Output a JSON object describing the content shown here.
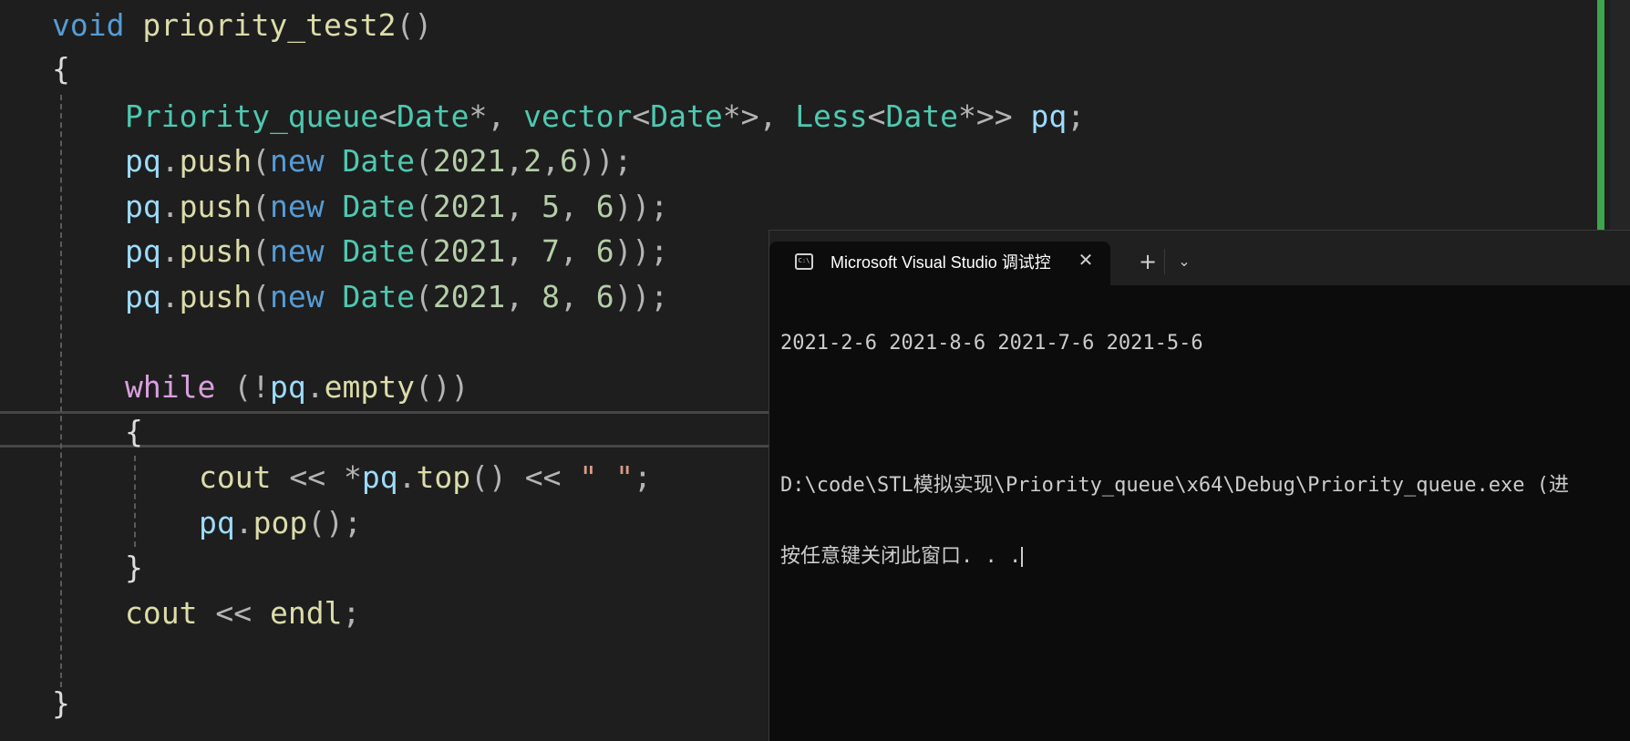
{
  "editor": {
    "lines": [
      {
        "tokens": [
          [
            "kw",
            "void"
          ],
          [
            "plain",
            " "
          ],
          [
            "fn",
            "priority_test2"
          ],
          [
            "punc",
            "()"
          ]
        ]
      },
      {
        "tokens": [
          [
            "brace",
            "{"
          ]
        ]
      },
      {
        "tokens": [
          [
            "type",
            "Priority_queue"
          ],
          [
            "punc",
            "<"
          ],
          [
            "type",
            "Date"
          ],
          [
            "punc",
            "*, "
          ],
          [
            "type",
            "vector"
          ],
          [
            "punc",
            "<"
          ],
          [
            "type",
            "Date"
          ],
          [
            "punc",
            "*>, "
          ],
          [
            "type",
            "Less"
          ],
          [
            "punc",
            "<"
          ],
          [
            "type",
            "Date"
          ],
          [
            "punc",
            "*>> "
          ],
          [
            "var",
            "pq"
          ],
          [
            "punc",
            ";"
          ]
        ]
      },
      {
        "tokens": [
          [
            "var",
            "pq"
          ],
          [
            "punc",
            "."
          ],
          [
            "fn",
            "push"
          ],
          [
            "punc",
            "("
          ],
          [
            "kw",
            "new"
          ],
          [
            "plain",
            " "
          ],
          [
            "type",
            "Date"
          ],
          [
            "punc",
            "("
          ],
          [
            "num",
            "2021"
          ],
          [
            "punc",
            ","
          ],
          [
            "num",
            "2"
          ],
          [
            "punc",
            ","
          ],
          [
            "num",
            "6"
          ],
          [
            "punc",
            "));"
          ]
        ]
      },
      {
        "tokens": [
          [
            "var",
            "pq"
          ],
          [
            "punc",
            "."
          ],
          [
            "fn",
            "push"
          ],
          [
            "punc",
            "("
          ],
          [
            "kw",
            "new"
          ],
          [
            "plain",
            " "
          ],
          [
            "type",
            "Date"
          ],
          [
            "punc",
            "("
          ],
          [
            "num",
            "2021"
          ],
          [
            "punc",
            ", "
          ],
          [
            "num",
            "5"
          ],
          [
            "punc",
            ", "
          ],
          [
            "num",
            "6"
          ],
          [
            "punc",
            "));"
          ]
        ]
      },
      {
        "tokens": [
          [
            "var",
            "pq"
          ],
          [
            "punc",
            "."
          ],
          [
            "fn",
            "push"
          ],
          [
            "punc",
            "("
          ],
          [
            "kw",
            "new"
          ],
          [
            "plain",
            " "
          ],
          [
            "type",
            "Date"
          ],
          [
            "punc",
            "("
          ],
          [
            "num",
            "2021"
          ],
          [
            "punc",
            ", "
          ],
          [
            "num",
            "7"
          ],
          [
            "punc",
            ", "
          ],
          [
            "num",
            "6"
          ],
          [
            "punc",
            "));"
          ]
        ]
      },
      {
        "tokens": [
          [
            "var",
            "pq"
          ],
          [
            "punc",
            "."
          ],
          [
            "fn",
            "push"
          ],
          [
            "punc",
            "("
          ],
          [
            "kw",
            "new"
          ],
          [
            "plain",
            " "
          ],
          [
            "type",
            "Date"
          ],
          [
            "punc",
            "("
          ],
          [
            "num",
            "2021"
          ],
          [
            "punc",
            ", "
          ],
          [
            "num",
            "8"
          ],
          [
            "punc",
            ", "
          ],
          [
            "num",
            "6"
          ],
          [
            "punc",
            "));"
          ]
        ]
      },
      {
        "tokens": []
      },
      {
        "tokens": [
          [
            "ctl",
            "while"
          ],
          [
            "plain",
            " "
          ],
          [
            "punc",
            "(!"
          ],
          [
            "var",
            "pq"
          ],
          [
            "punc",
            "."
          ],
          [
            "fn",
            "empty"
          ],
          [
            "punc",
            "())"
          ]
        ]
      },
      {
        "tokens": [
          [
            "brace",
            "{"
          ]
        ]
      },
      {
        "tokens": [
          [
            "fn",
            "cout"
          ],
          [
            "plain",
            " "
          ],
          [
            "op",
            "<<"
          ],
          [
            "plain",
            " "
          ],
          [
            "op",
            "*"
          ],
          [
            "var",
            "pq"
          ],
          [
            "punc",
            "."
          ],
          [
            "fn",
            "top"
          ],
          [
            "punc",
            "()"
          ],
          [
            "plain",
            " "
          ],
          [
            "op",
            "<<"
          ],
          [
            "plain",
            " "
          ],
          [
            "str",
            "\" \""
          ],
          [
            "punc",
            ";"
          ]
        ]
      },
      {
        "tokens": [
          [
            "var",
            "pq"
          ],
          [
            "punc",
            "."
          ],
          [
            "fn",
            "pop"
          ],
          [
            "punc",
            "();"
          ]
        ]
      },
      {
        "tokens": [
          [
            "brace",
            "}"
          ]
        ]
      },
      {
        "tokens": [
          [
            "fn",
            "cout"
          ],
          [
            "plain",
            " "
          ],
          [
            "op",
            "<<"
          ],
          [
            "plain",
            " "
          ],
          [
            "fn",
            "endl"
          ],
          [
            "punc",
            ";"
          ]
        ]
      },
      {
        "tokens": []
      },
      {
        "tokens": [
          [
            "brace",
            "}"
          ]
        ]
      }
    ]
  },
  "terminal": {
    "tab_title": "Microsoft Visual Studio 调试控",
    "tab_icon": "console-icon",
    "close_glyph": "✕",
    "new_tab_glyph": "+",
    "dropdown_glyph": "⌄",
    "output": [
      "2021-2-6 2021-8-6 2021-7-6 2021-5-6",
      "",
      "D:\\code\\STL模拟实现\\Priority_queue\\x64\\Debug\\Priority_queue.exe (进",
      "按任意键关闭此窗口. . ."
    ]
  }
}
